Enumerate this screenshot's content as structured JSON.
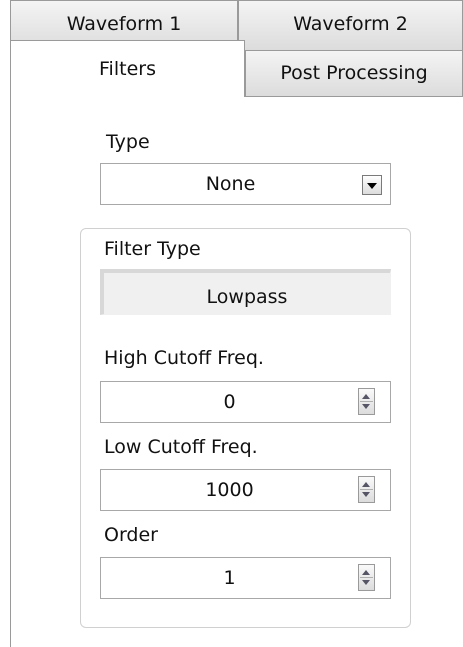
{
  "tabs": {
    "row1": [
      "Waveform 1",
      "Waveform 2"
    ],
    "row2": [
      "Filters",
      "Post Processing"
    ],
    "active": "Filters"
  },
  "type": {
    "label": "Type",
    "value": "None"
  },
  "filter_type": {
    "label": "Filter Type",
    "value": "Lowpass"
  },
  "high_cutoff": {
    "label": "High Cutoff Freq.",
    "value": "0"
  },
  "low_cutoff": {
    "label": "Low Cutoff Freq.",
    "value": "1000"
  },
  "order": {
    "label": "Order",
    "value": "1"
  }
}
